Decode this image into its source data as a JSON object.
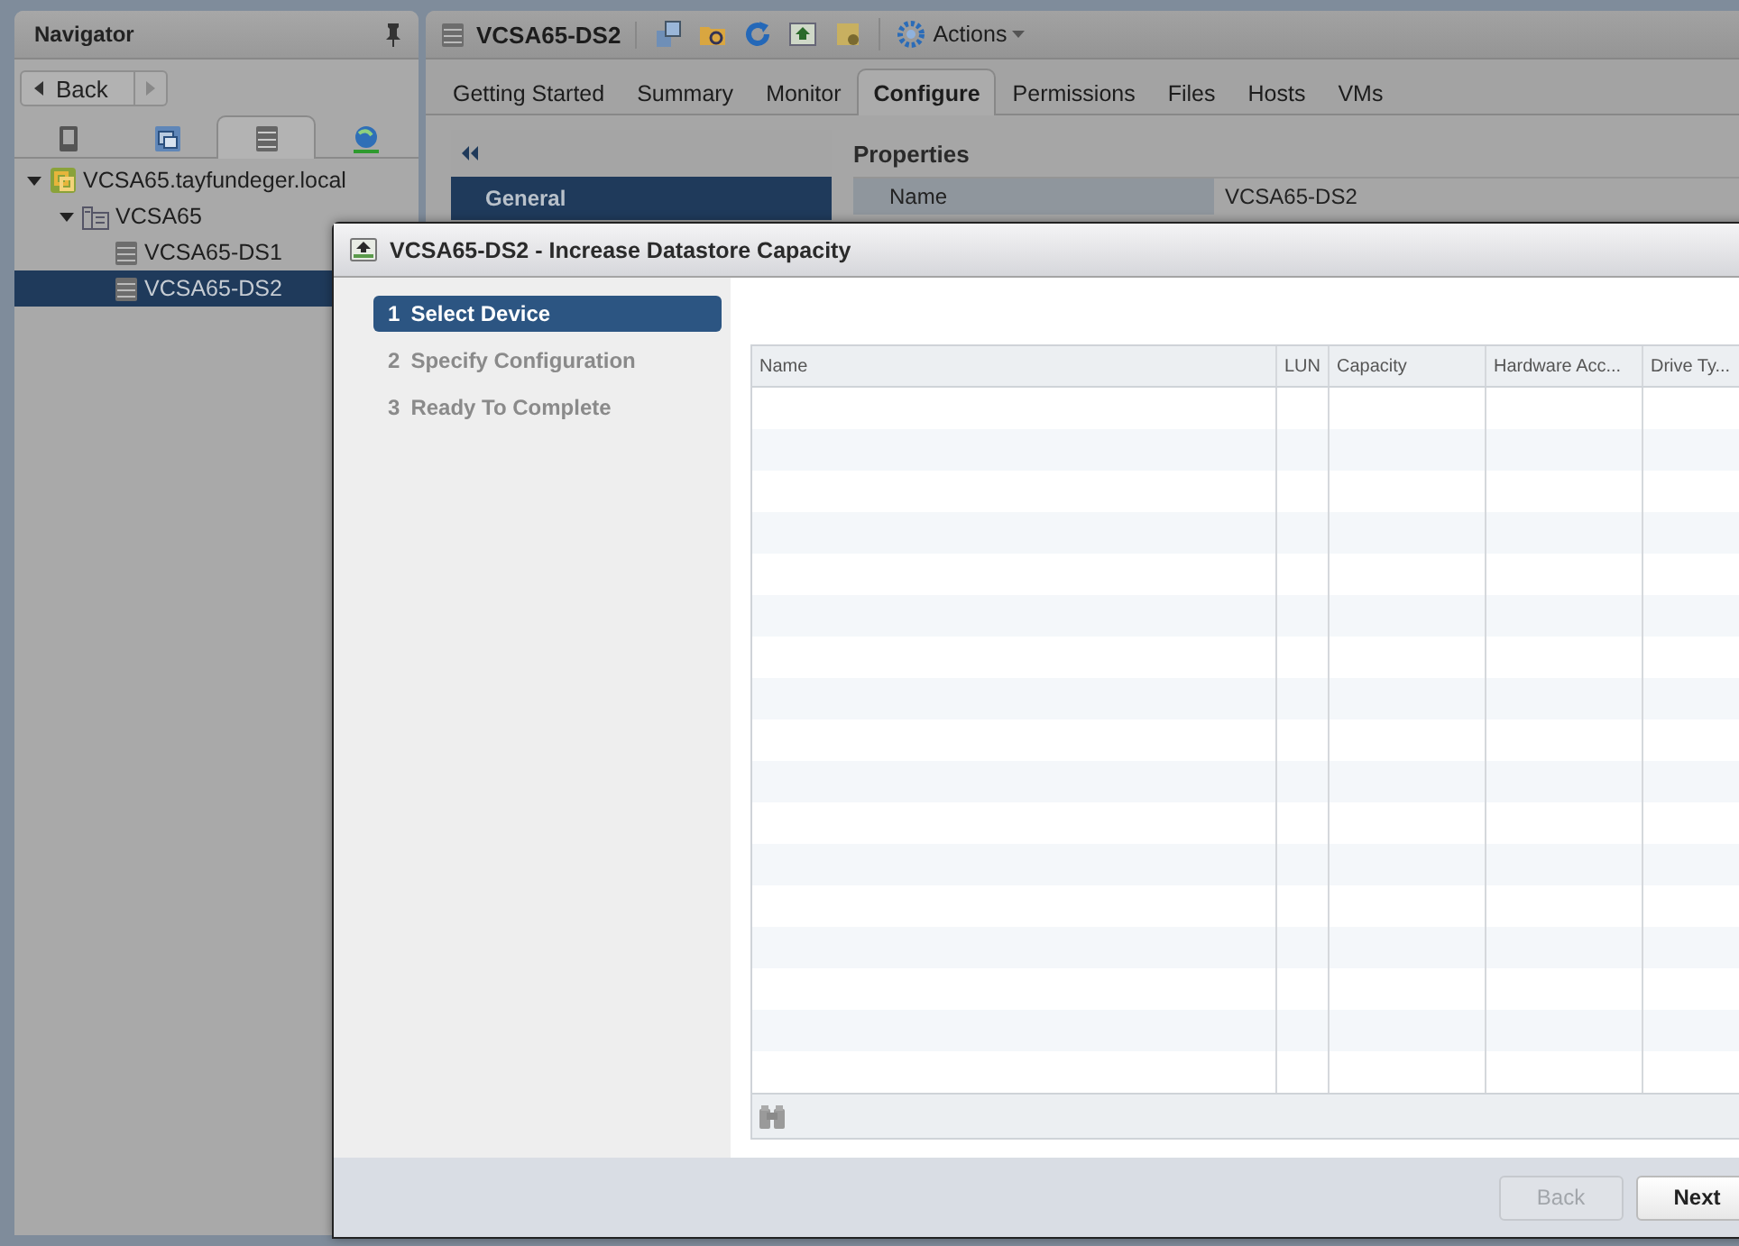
{
  "navigator": {
    "title": "Navigator",
    "back": "Back",
    "tabs": [
      {
        "kind": "hosts",
        "selected": false
      },
      {
        "kind": "vms",
        "selected": false
      },
      {
        "kind": "storage",
        "selected": true
      },
      {
        "kind": "network",
        "selected": false
      }
    ],
    "tree": [
      {
        "label": "VCSA65.tayfundeger.local",
        "kind": "vcenter",
        "expanded": true,
        "selected": false,
        "children": [
          {
            "label": "VCSA65",
            "kind": "datacenter",
            "expanded": true,
            "selected": false,
            "children": [
              {
                "label": "VCSA65-DS1",
                "kind": "datastore",
                "selected": false
              },
              {
                "label": "VCSA65-DS2",
                "kind": "datastore",
                "selected": true
              }
            ]
          }
        ]
      }
    ]
  },
  "object": {
    "title": "VCSA65-DS2",
    "actions": "Actions",
    "tabs": [
      {
        "label": "Getting Started",
        "selected": false
      },
      {
        "label": "Summary",
        "selected": false
      },
      {
        "label": "Monitor",
        "selected": false
      },
      {
        "label": "Configure",
        "selected": true
      },
      {
        "label": "Permissions",
        "selected": false
      },
      {
        "label": "Files",
        "selected": false
      },
      {
        "label": "Hosts",
        "selected": false
      },
      {
        "label": "VMs",
        "selected": false
      }
    ],
    "sidebar": {
      "items": [
        {
          "label": "General",
          "selected": true
        }
      ]
    },
    "properties": {
      "title": "Properties",
      "rows": [
        {
          "label": "Name",
          "value": "VCSA65-DS2"
        }
      ]
    }
  },
  "dialog": {
    "title": "VCSA65-DS2 - Increase Datastore Capacity",
    "steps": [
      {
        "number": "1",
        "label": "Select Device",
        "selected": true
      },
      {
        "number": "2",
        "label": "Specify Configuration",
        "selected": false
      },
      {
        "number": "3",
        "label": "Ready To Complete",
        "selected": false
      }
    ],
    "table": {
      "columns": [
        "Name",
        "LUN",
        "Capacity",
        "Hardware Acc...",
        "Drive Ty..."
      ]
    },
    "buttons": [
      {
        "label": "Back",
        "disabled": true
      },
      {
        "label": "Next",
        "disabled": false
      }
    ]
  }
}
